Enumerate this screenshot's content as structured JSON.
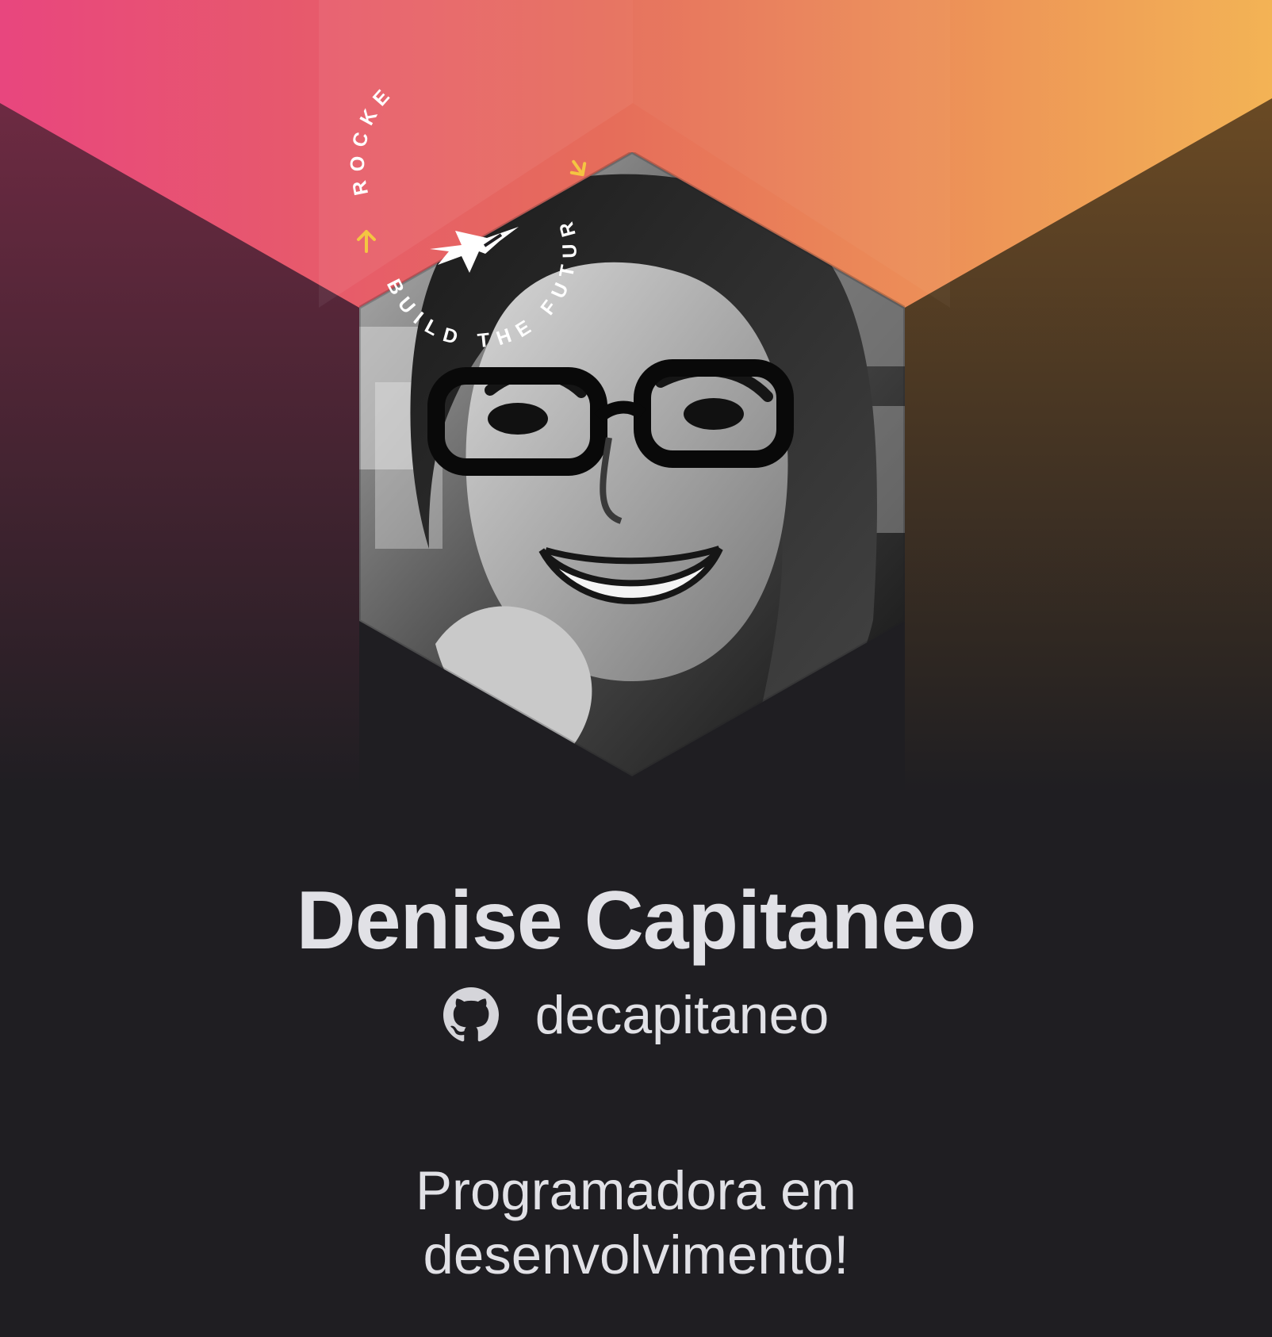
{
  "profile": {
    "name": "Denise Capitaneo",
    "github_username": "decapitaneo",
    "bio": "Programadora em\ndesenvolvimento!"
  },
  "seal": {
    "text_top": "ROCKETSEAT",
    "text_bottom": "BUILD THE FUTURE"
  },
  "icons": {
    "github": "github-icon",
    "rocket": "rocket-icon",
    "photo": "avatar-photo"
  },
  "colors": {
    "background": "#1f1e22",
    "text": "#e1e1e6",
    "gradient_start": "#e8467e",
    "gradient_mid": "#eb7a5c",
    "gradient_end": "#f3b355",
    "seal_arrow": "#f4c542"
  }
}
